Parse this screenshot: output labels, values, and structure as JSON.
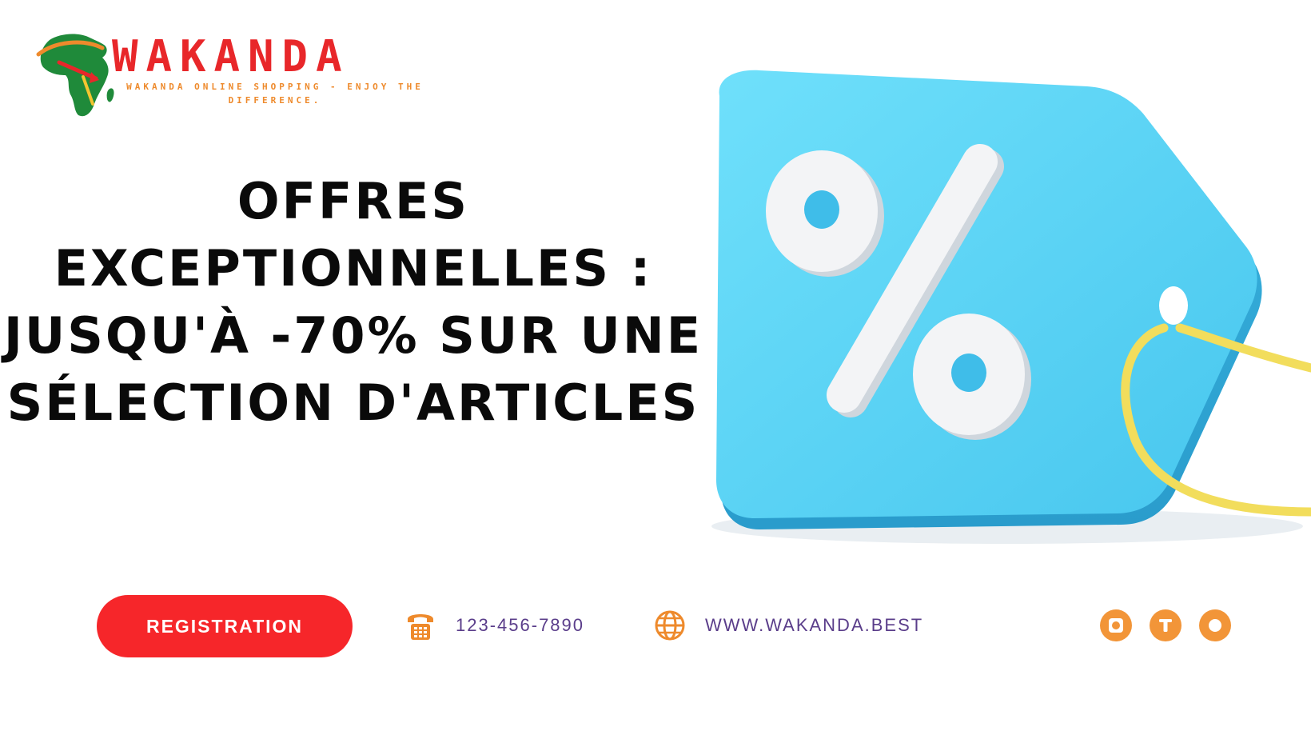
{
  "brand": {
    "name": "WAKANDA",
    "tagline": "WAKANDA ONLINE SHOPPING - ENJOY THE DIFFERENCE.",
    "colors": {
      "red": "#e8272a",
      "orange": "#ee8a2c",
      "green": "#1f8a3a"
    }
  },
  "headline": {
    "lines": [
      "OFFRES",
      "EXCEPTIONNELLES :",
      "JUSQU'À -70% SUR UNE",
      "SÉLECTION D'ARTICLES"
    ]
  },
  "illustration": {
    "icon": "percent-price-tag-icon",
    "tag_color": "#5ad4f6",
    "string_color": "#f2dd5c"
  },
  "cta": {
    "label": "REGISTRATION",
    "color": "#f6262a"
  },
  "contact": {
    "phone": "123-456-7890",
    "phone_icon": "phone-icon",
    "website": "WWW.WAKANDA.BEST",
    "website_icon": "globe-icon",
    "text_color": "#5a3d8a",
    "icon_color": "#ee8a2c"
  },
  "social": [
    {
      "icon": "instagram-icon"
    },
    {
      "icon": "twitter-icon"
    },
    {
      "icon": "circle-icon"
    }
  ]
}
